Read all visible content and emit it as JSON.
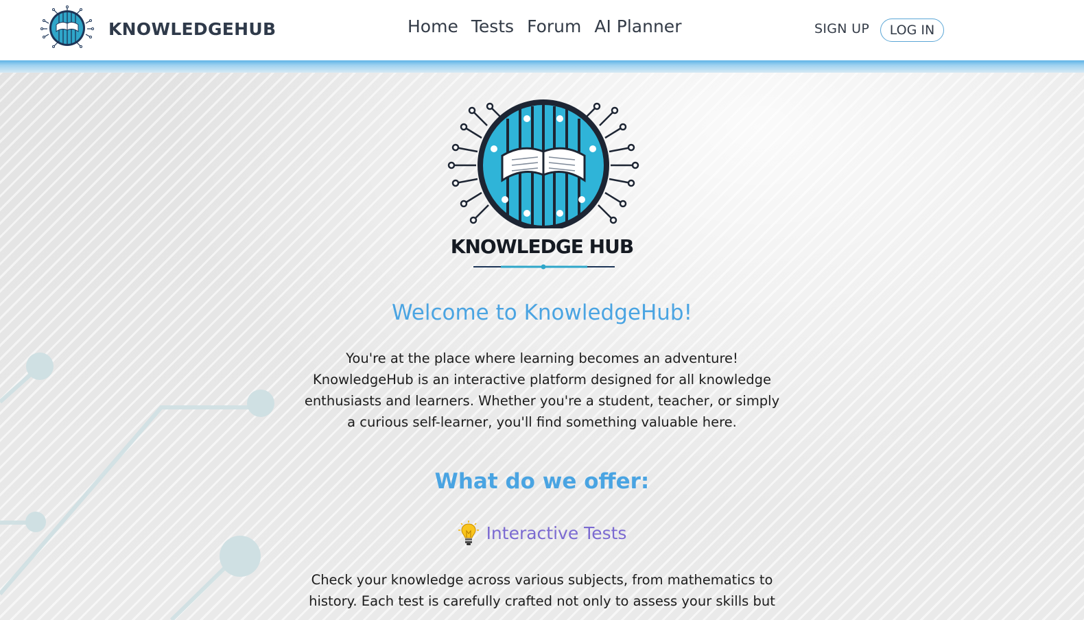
{
  "brand": {
    "name": "KNOWLEDGEHUB",
    "logo_icon": "knowledgehub-logo-icon",
    "logo_caption": "KNOWLEDGE HUB"
  },
  "nav": {
    "items": [
      {
        "label": "Home"
      },
      {
        "label": "Tests"
      },
      {
        "label": "Forum"
      },
      {
        "label": "AI Planner"
      }
    ]
  },
  "auth": {
    "signup": "SIGN UP",
    "login": "LOG IN"
  },
  "hero": {
    "logo_text": "KNOWLEDGE HUB"
  },
  "welcome": {
    "title": "Welcome to KnowledgeHub!",
    "text": "You're at the place where learning becomes an adventure! KnowledgeHub is an interactive platform designed for all knowledge enthusiasts and learners. Whether you're a student, teacher, or simply a curious self-learner, you'll find something valuable here."
  },
  "offer": {
    "title": "What do we offer:",
    "features": [
      {
        "icon": "lightbulb-icon",
        "title": "Interactive Tests",
        "text": "Check your knowledge across various subjects, from mathematics to history. Each test is carefully crafted not only to assess your skills but"
      }
    ]
  },
  "colors": {
    "accent": "#4aa4e2",
    "feature": "#7b6ad1",
    "navy": "#1d3557",
    "strip": "#5fb3e6"
  }
}
